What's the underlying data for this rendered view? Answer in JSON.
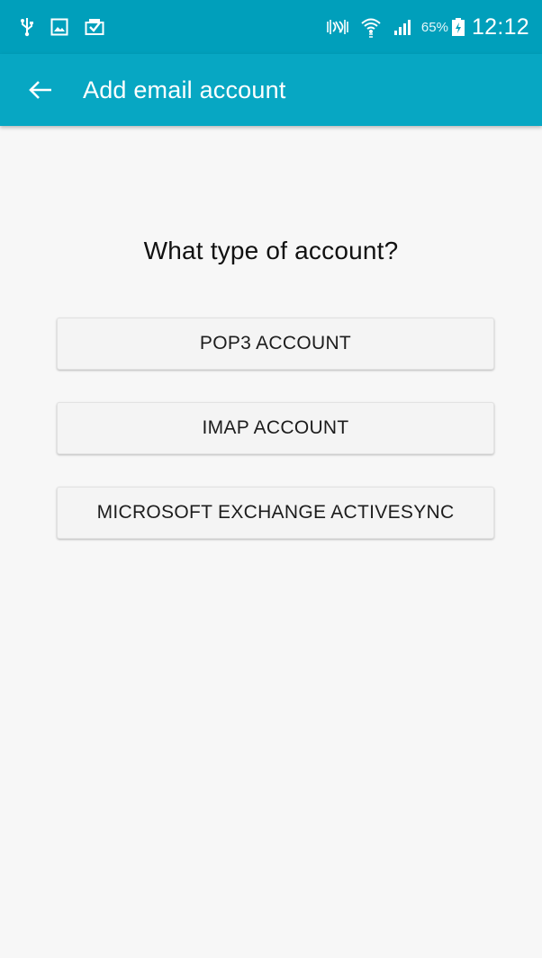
{
  "status_bar": {
    "battery_percent": "65%",
    "time": "12:12",
    "icons": [
      "usb-icon",
      "screenshot-icon",
      "image-check-icon",
      "nfc-icon",
      "wifi-icon",
      "signal-icon",
      "battery-charging-icon"
    ]
  },
  "app_bar": {
    "back_icon": "arrow-left-icon",
    "title": "Add email account"
  },
  "main": {
    "question": "What type of account?",
    "options": [
      {
        "label": "POP3 ACCOUNT"
      },
      {
        "label": "IMAP ACCOUNT"
      },
      {
        "label": "MICROSOFT EXCHANGE ACTIVESYNC"
      }
    ]
  },
  "colors": {
    "status_bar": "#009fbb",
    "app_bar": "#07a7c3",
    "background": "#f7f7f7"
  }
}
